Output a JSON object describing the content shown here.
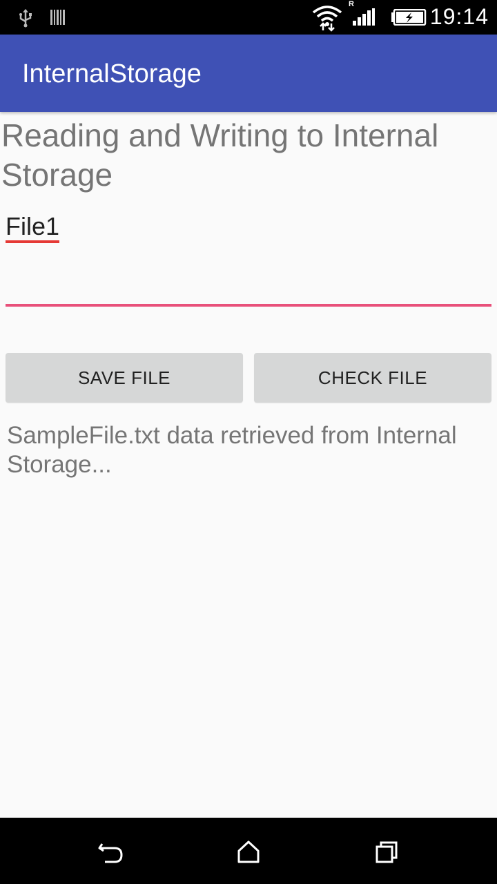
{
  "status_bar": {
    "time": "19:14",
    "roaming_indicator": "R",
    "icons": [
      "usb-icon",
      "barcode-icon",
      "wifi-icon",
      "signal-icon",
      "battery-charging-icon"
    ]
  },
  "app_bar": {
    "title": "InternalStorage",
    "color": "#3f51b5"
  },
  "main": {
    "heading": "Reading and Writing to Internal Storage",
    "file_name": "File1",
    "content_input": {
      "value": "",
      "placeholder": ""
    },
    "save_button_label": "SAVE FILE",
    "check_button_label": "CHECK FILE",
    "result_text": "SampleFile.txt data retrieved from Internal Storage..."
  },
  "nav_bar": {
    "icons": [
      "back-icon",
      "home-icon",
      "recents-icon"
    ]
  },
  "colors": {
    "accent": "#e8507a",
    "button_bg": "#d6d7d7",
    "background": "#fafafa"
  }
}
